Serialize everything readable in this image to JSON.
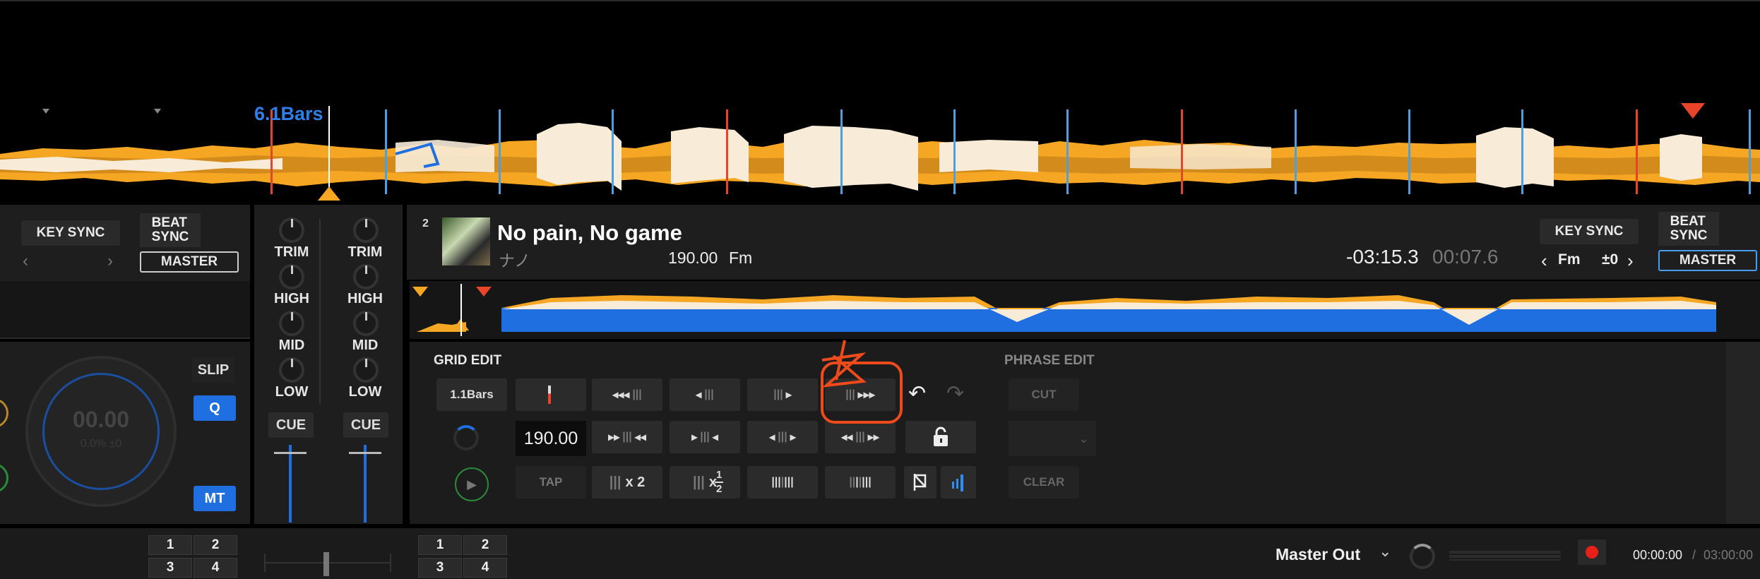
{
  "top_overview": {
    "bars_label": "6.1Bars"
  },
  "deck_left": {
    "key_sync": "KEY SYNC",
    "beat_sync": "BEAT\nSYNC",
    "master": "MASTER",
    "slip": "SLIP",
    "q": "Q",
    "mt": "MT",
    "tempo_value": "00.00",
    "tempo_sub": "0.0% ±0"
  },
  "mixer": {
    "ch1": {
      "trim": "TRIM",
      "high": "HIGH",
      "mid": "MID",
      "low": "LOW",
      "cue": "CUE"
    },
    "ch2": {
      "trim": "TRIM",
      "high": "HIGH",
      "mid": "MID",
      "low": "LOW",
      "cue": "CUE"
    }
  },
  "deck_right": {
    "deck_number": "2",
    "track_title": "No pain, No game",
    "artist": "ナノ",
    "bpm": "190.00",
    "key": "Fm",
    "remaining_time": "-03:15.3",
    "elapsed_time": "00:07.6",
    "key_sync": "KEY SYNC",
    "key_value": "Fm",
    "key_offset": "±0",
    "beat_sync": "BEAT\nSYNC",
    "master": "MASTER"
  },
  "grid_edit": {
    "title": "GRID EDIT",
    "bars_button": "1.1Bars",
    "bpm_value": "190.00",
    "tap": "TAP",
    "x2_label": "x 2",
    "x_half_label": "x",
    "half_num": "1",
    "half_den": "2"
  },
  "phrase_edit": {
    "title": "PHRASE EDIT",
    "cut": "CUT",
    "clear": "CLEAR"
  },
  "bottom": {
    "pads_left": [
      "1",
      "2",
      "3",
      "4"
    ],
    "pads_right": [
      "1",
      "2",
      "3",
      "4"
    ],
    "master_out": "Master Out",
    "rec_time": "00:00:00",
    "rec_sep": "/",
    "rec_total": "03:00:00"
  },
  "colors": {
    "accent_blue": "#1f6fe0",
    "wave_orange": "#f5a623",
    "wave_cream": "#f8ecd9",
    "cue_red": "#e8442a",
    "annotation_red": "#ee4a1c"
  }
}
